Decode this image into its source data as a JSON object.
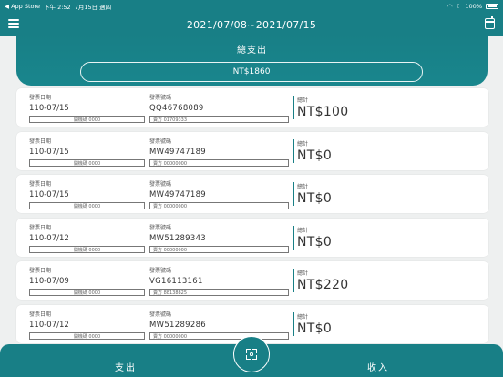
{
  "status_bar": {
    "back_label": "◀ App Store",
    "time": "下午 2:52",
    "date": "7月15日 週四",
    "battery": "100%"
  },
  "header": {
    "title": "2021/07/08~2021/07/15"
  },
  "summary": {
    "label": "總支出",
    "total": "NT$1860"
  },
  "labels": {
    "date": "發票日期",
    "number": "發票號碼",
    "total": "總計"
  },
  "invoices": [
    {
      "date": "110-07/15",
      "number": "QQ46768089",
      "pos": "開機碼 0000",
      "seller": "賣方 01709333",
      "total": "NT$100"
    },
    {
      "date": "110-07/15",
      "number": "MW49747189",
      "pos": "開機碼 0000",
      "seller": "賣方 00000000",
      "total": "NT$0"
    },
    {
      "date": "110-07/15",
      "number": "MW49747189",
      "pos": "開機碼 0000",
      "seller": "賣方 00000000",
      "total": "NT$0"
    },
    {
      "date": "110-07/12",
      "number": "MW51289343",
      "pos": "開機碼 0000",
      "seller": "賣方 00000000",
      "total": "NT$0"
    },
    {
      "date": "110-07/09",
      "number": "VG16113161",
      "pos": "開機碼 0000",
      "seller": "賣方 88138825",
      "total": "NT$220"
    },
    {
      "date": "110-07/12",
      "number": "MW51289286",
      "pos": "開機碼 0000",
      "seller": "賣方 00000000",
      "total": "NT$0"
    }
  ],
  "bottom_bar": {
    "expense_label": "支出",
    "income_label": "收入"
  },
  "colors": {
    "brand": "#187f86",
    "background": "#eef0f0",
    "card": "#ffffff"
  },
  "icons": {
    "menu": "hamburger-icon",
    "calendar": "calendar-icon",
    "scan": "scan-icon"
  }
}
